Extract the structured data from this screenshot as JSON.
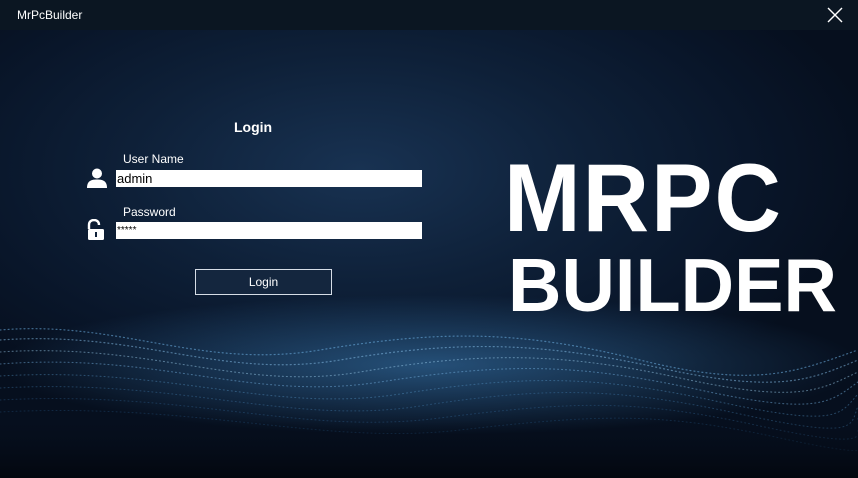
{
  "window": {
    "title": "MrPcBuilder"
  },
  "login": {
    "heading": "Login",
    "username_label": "User Name",
    "username_value": "admin",
    "password_label": "Password",
    "password_value": "*****",
    "button_label": "Login"
  },
  "logo": {
    "line1": "MRPC",
    "line2": "BUILDER"
  },
  "icons": {
    "close": "close-icon",
    "user": "user-icon",
    "lock": "unlock-icon"
  },
  "colors": {
    "background": "#0e2038",
    "titlebar": "#0b1622",
    "button_bg": "#14263e",
    "button_border": "#d6dde6",
    "text": "#ffffff"
  }
}
